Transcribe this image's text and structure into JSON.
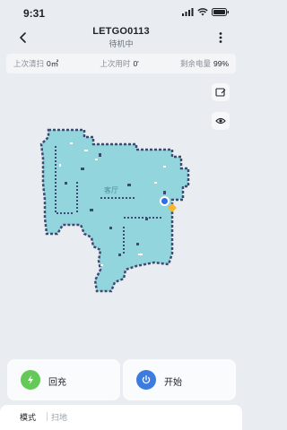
{
  "status_bar": {
    "time": "9:31"
  },
  "nav": {
    "title": "LETGO0113",
    "subtitle": "待机中"
  },
  "stats": [
    {
      "label": "上次清扫",
      "value": "0㎡"
    },
    {
      "label": "上次用时",
      "value": "0'"
    },
    {
      "label": "剩余电量",
      "value": "99%"
    }
  ],
  "map": {
    "room_label": "客厅",
    "map_color": "#92d5dd",
    "wall_color": "#3f4a73"
  },
  "actions": {
    "recharge": {
      "label": "回充",
      "icon": "recharge-icon",
      "color": "#65c958"
    },
    "start": {
      "label": "开始",
      "icon": "power-icon",
      "color": "#3c7be0"
    }
  },
  "bottom": {
    "mode_label": "模式",
    "mode_value": "扫地"
  }
}
